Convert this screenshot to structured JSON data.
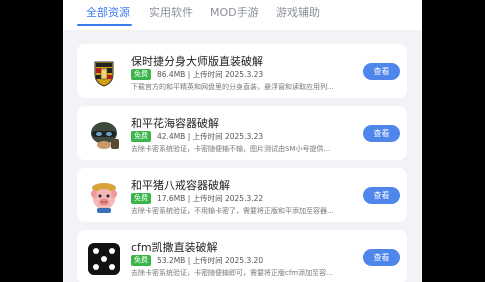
{
  "tabs": [
    {
      "label": "全部资源"
    },
    {
      "label": "实用软件"
    },
    {
      "label": "MOD手游"
    },
    {
      "label": "游戏辅助"
    }
  ],
  "active_tab_index": 0,
  "colors": {
    "accent": "#3a7bf0",
    "free_badge": "#39b54a",
    "button": "#4f86ec"
  },
  "items": [
    {
      "title": "保时捷分身大师版直装破解",
      "badge": "免费",
      "meta": "86.4MB | 上传时间 2025.3.23",
      "desc": "下载官方的和平精英和网盘里的分身直装，悬浮窗和读取应用列...",
      "button": "查看",
      "icon": "porsche-logo-icon"
    },
    {
      "title": "和平花海容器破解",
      "badge": "免费",
      "meta": "42.4MB | 上传时间 2025.3.23",
      "desc": "去除卡密系统验证，卡密随便输不输，图片测试由SM小号提供...",
      "button": "查看",
      "icon": "helmet-avatar-icon"
    },
    {
      "title": "和平猪八戒容器破解",
      "badge": "免费",
      "meta": "17.6MB | 上传时间 2025.3.22",
      "desc": "去除卡密系统验证，不用输卡密了，需要将正版和平添加至容器...",
      "button": "查看",
      "icon": "pig-avatar-icon"
    },
    {
      "title": "cfm凯撒直装破解",
      "badge": "免费",
      "meta": "53.2MB | 上传时间 2025.3.20",
      "desc": "去除卡密系统验证，卡密随便输即可，需要将正版cfm添加至容...",
      "button": "查看",
      "icon": "dice-icon"
    }
  ]
}
